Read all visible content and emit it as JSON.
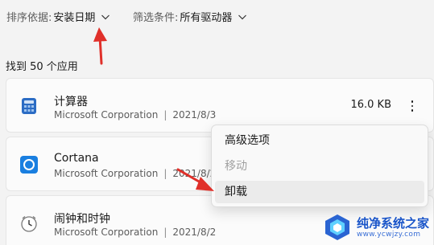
{
  "filters": {
    "sort_label": "排序依据:",
    "sort_value": "安装日期",
    "filter_label": "筛选条件:",
    "filter_value": "所有驱动器"
  },
  "found_text": "找到 50 个应用",
  "apps": [
    {
      "name": "计算器",
      "publisher": "Microsoft Corporation",
      "separator": "|",
      "date": "2021/8/3",
      "size": "16.0 KB",
      "icon": "calculator-icon"
    },
    {
      "name": "Cortana",
      "publisher": "Microsoft Corporation",
      "separator": "|",
      "date": "2021/8/2",
      "size": "",
      "icon": "cortana-icon"
    },
    {
      "name": "闹钟和时钟",
      "publisher": "Microsoft Corporation",
      "separator": "|",
      "date": "2021/8/2",
      "size": "",
      "icon": "alarm-clock-icon"
    }
  ],
  "context_menu": {
    "items": [
      {
        "label": "高级选项",
        "state": "normal"
      },
      {
        "label": "移动",
        "state": "disabled"
      },
      {
        "label": "卸载",
        "state": "hover"
      }
    ]
  },
  "annotations": {
    "arrow_color": "#e0302a"
  },
  "watermark": {
    "title": "纯净系统之家",
    "subtitle": "www.ycwjzy.com"
  },
  "colors": {
    "accent": "#0067c0",
    "background": "#f3f3f3",
    "card": "#fbfbfb"
  }
}
